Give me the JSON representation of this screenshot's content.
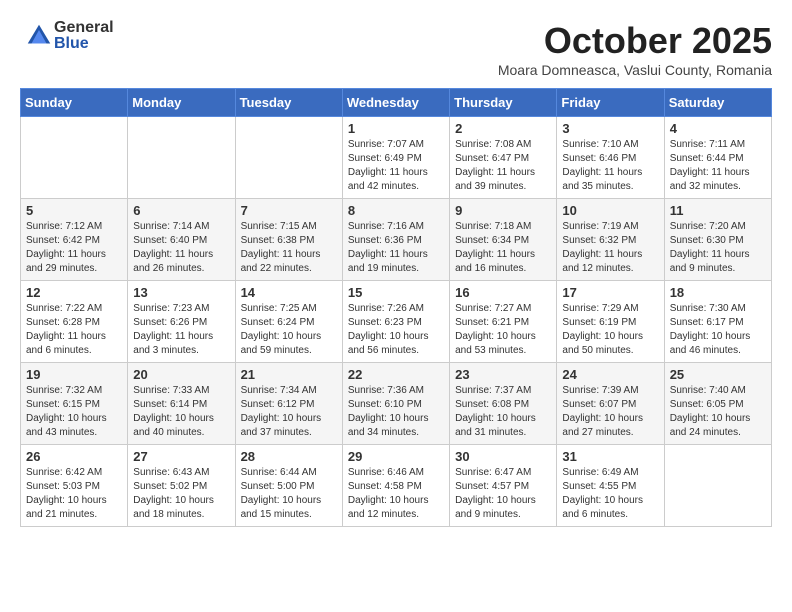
{
  "logo": {
    "general": "General",
    "blue": "Blue"
  },
  "title": "October 2025",
  "subtitle": "Moara Domneasca, Vaslui County, Romania",
  "days_header": [
    "Sunday",
    "Monday",
    "Tuesday",
    "Wednesday",
    "Thursday",
    "Friday",
    "Saturday"
  ],
  "weeks": [
    [
      {
        "num": "",
        "info": ""
      },
      {
        "num": "",
        "info": ""
      },
      {
        "num": "",
        "info": ""
      },
      {
        "num": "1",
        "info": "Sunrise: 7:07 AM\nSunset: 6:49 PM\nDaylight: 11 hours and 42 minutes."
      },
      {
        "num": "2",
        "info": "Sunrise: 7:08 AM\nSunset: 6:47 PM\nDaylight: 11 hours and 39 minutes."
      },
      {
        "num": "3",
        "info": "Sunrise: 7:10 AM\nSunset: 6:46 PM\nDaylight: 11 hours and 35 minutes."
      },
      {
        "num": "4",
        "info": "Sunrise: 7:11 AM\nSunset: 6:44 PM\nDaylight: 11 hours and 32 minutes."
      }
    ],
    [
      {
        "num": "5",
        "info": "Sunrise: 7:12 AM\nSunset: 6:42 PM\nDaylight: 11 hours and 29 minutes."
      },
      {
        "num": "6",
        "info": "Sunrise: 7:14 AM\nSunset: 6:40 PM\nDaylight: 11 hours and 26 minutes."
      },
      {
        "num": "7",
        "info": "Sunrise: 7:15 AM\nSunset: 6:38 PM\nDaylight: 11 hours and 22 minutes."
      },
      {
        "num": "8",
        "info": "Sunrise: 7:16 AM\nSunset: 6:36 PM\nDaylight: 11 hours and 19 minutes."
      },
      {
        "num": "9",
        "info": "Sunrise: 7:18 AM\nSunset: 6:34 PM\nDaylight: 11 hours and 16 minutes."
      },
      {
        "num": "10",
        "info": "Sunrise: 7:19 AM\nSunset: 6:32 PM\nDaylight: 11 hours and 12 minutes."
      },
      {
        "num": "11",
        "info": "Sunrise: 7:20 AM\nSunset: 6:30 PM\nDaylight: 11 hours and 9 minutes."
      }
    ],
    [
      {
        "num": "12",
        "info": "Sunrise: 7:22 AM\nSunset: 6:28 PM\nDaylight: 11 hours and 6 minutes."
      },
      {
        "num": "13",
        "info": "Sunrise: 7:23 AM\nSunset: 6:26 PM\nDaylight: 11 hours and 3 minutes."
      },
      {
        "num": "14",
        "info": "Sunrise: 7:25 AM\nSunset: 6:24 PM\nDaylight: 10 hours and 59 minutes."
      },
      {
        "num": "15",
        "info": "Sunrise: 7:26 AM\nSunset: 6:23 PM\nDaylight: 10 hours and 56 minutes."
      },
      {
        "num": "16",
        "info": "Sunrise: 7:27 AM\nSunset: 6:21 PM\nDaylight: 10 hours and 53 minutes."
      },
      {
        "num": "17",
        "info": "Sunrise: 7:29 AM\nSunset: 6:19 PM\nDaylight: 10 hours and 50 minutes."
      },
      {
        "num": "18",
        "info": "Sunrise: 7:30 AM\nSunset: 6:17 PM\nDaylight: 10 hours and 46 minutes."
      }
    ],
    [
      {
        "num": "19",
        "info": "Sunrise: 7:32 AM\nSunset: 6:15 PM\nDaylight: 10 hours and 43 minutes."
      },
      {
        "num": "20",
        "info": "Sunrise: 7:33 AM\nSunset: 6:14 PM\nDaylight: 10 hours and 40 minutes."
      },
      {
        "num": "21",
        "info": "Sunrise: 7:34 AM\nSunset: 6:12 PM\nDaylight: 10 hours and 37 minutes."
      },
      {
        "num": "22",
        "info": "Sunrise: 7:36 AM\nSunset: 6:10 PM\nDaylight: 10 hours and 34 minutes."
      },
      {
        "num": "23",
        "info": "Sunrise: 7:37 AM\nSunset: 6:08 PM\nDaylight: 10 hours and 31 minutes."
      },
      {
        "num": "24",
        "info": "Sunrise: 7:39 AM\nSunset: 6:07 PM\nDaylight: 10 hours and 27 minutes."
      },
      {
        "num": "25",
        "info": "Sunrise: 7:40 AM\nSunset: 6:05 PM\nDaylight: 10 hours and 24 minutes."
      }
    ],
    [
      {
        "num": "26",
        "info": "Sunrise: 6:42 AM\nSunset: 5:03 PM\nDaylight: 10 hours and 21 minutes."
      },
      {
        "num": "27",
        "info": "Sunrise: 6:43 AM\nSunset: 5:02 PM\nDaylight: 10 hours and 18 minutes."
      },
      {
        "num": "28",
        "info": "Sunrise: 6:44 AM\nSunset: 5:00 PM\nDaylight: 10 hours and 15 minutes."
      },
      {
        "num": "29",
        "info": "Sunrise: 6:46 AM\nSunset: 4:58 PM\nDaylight: 10 hours and 12 minutes."
      },
      {
        "num": "30",
        "info": "Sunrise: 6:47 AM\nSunset: 4:57 PM\nDaylight: 10 hours and 9 minutes."
      },
      {
        "num": "31",
        "info": "Sunrise: 6:49 AM\nSunset: 4:55 PM\nDaylight: 10 hours and 6 minutes."
      },
      {
        "num": "",
        "info": ""
      }
    ]
  ]
}
